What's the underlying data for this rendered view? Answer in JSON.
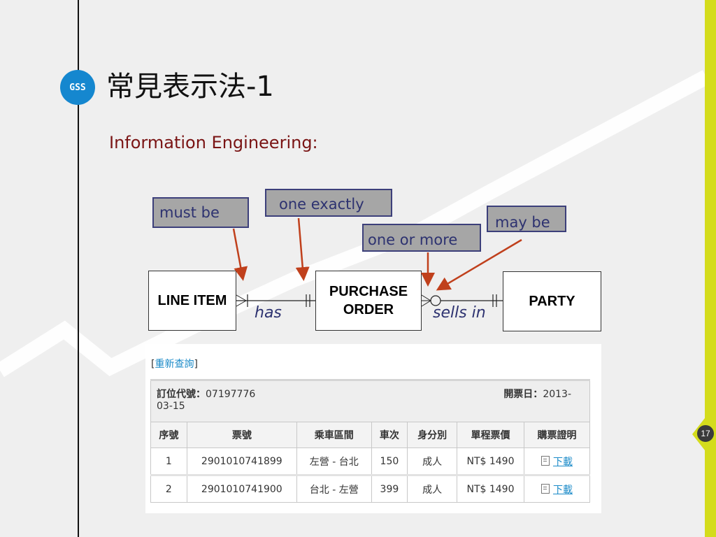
{
  "slide": {
    "title": "常見表示法-1",
    "subtitle": "Information Engineering:",
    "logo_text": "GSS",
    "page_number": "17",
    "colors": {
      "accent_bar": "#d4dc1c",
      "logo_blue": "#1587cf",
      "subtitle": "#7a1414",
      "callout_fill": "#a6a6a6",
      "callout_border": "#3c3f7a",
      "arrow": "#c0401c"
    }
  },
  "diagram": {
    "callouts": {
      "must_be": "must be",
      "one_exactly": "one exactly",
      "one_or_more": "one or more",
      "may_be": "may be"
    },
    "entities": {
      "line_item": "LINE ITEM",
      "purchase_order_1": "PURCHASE",
      "purchase_order_2": "ORDER",
      "party": "PARTY"
    },
    "relationships": {
      "has": "has",
      "sells_in": "sells in"
    }
  },
  "ticket_panel": {
    "requery_open": "[",
    "requery_link": "重新查詢",
    "requery_close": "]",
    "booking_code_label": "訂位代號：",
    "booking_code": "07197776",
    "issue_date_label": "開票日：",
    "issue_date": "2013-03-15",
    "columns": [
      "序號",
      "票號",
      "乘車區間",
      "車次",
      "身分別",
      "單程票價",
      "購票證明"
    ],
    "rows": [
      {
        "seq": "1",
        "ticket_no": "2901010741899",
        "route": "左營 - 台北",
        "train": "150",
        "identity": "成人",
        "fare": "NT$ 1490",
        "proof": "下載"
      },
      {
        "seq": "2",
        "ticket_no": "2901010741900",
        "route": "台北 - 左營",
        "train": "399",
        "identity": "成人",
        "fare": "NT$ 1490",
        "proof": "下載"
      }
    ]
  }
}
